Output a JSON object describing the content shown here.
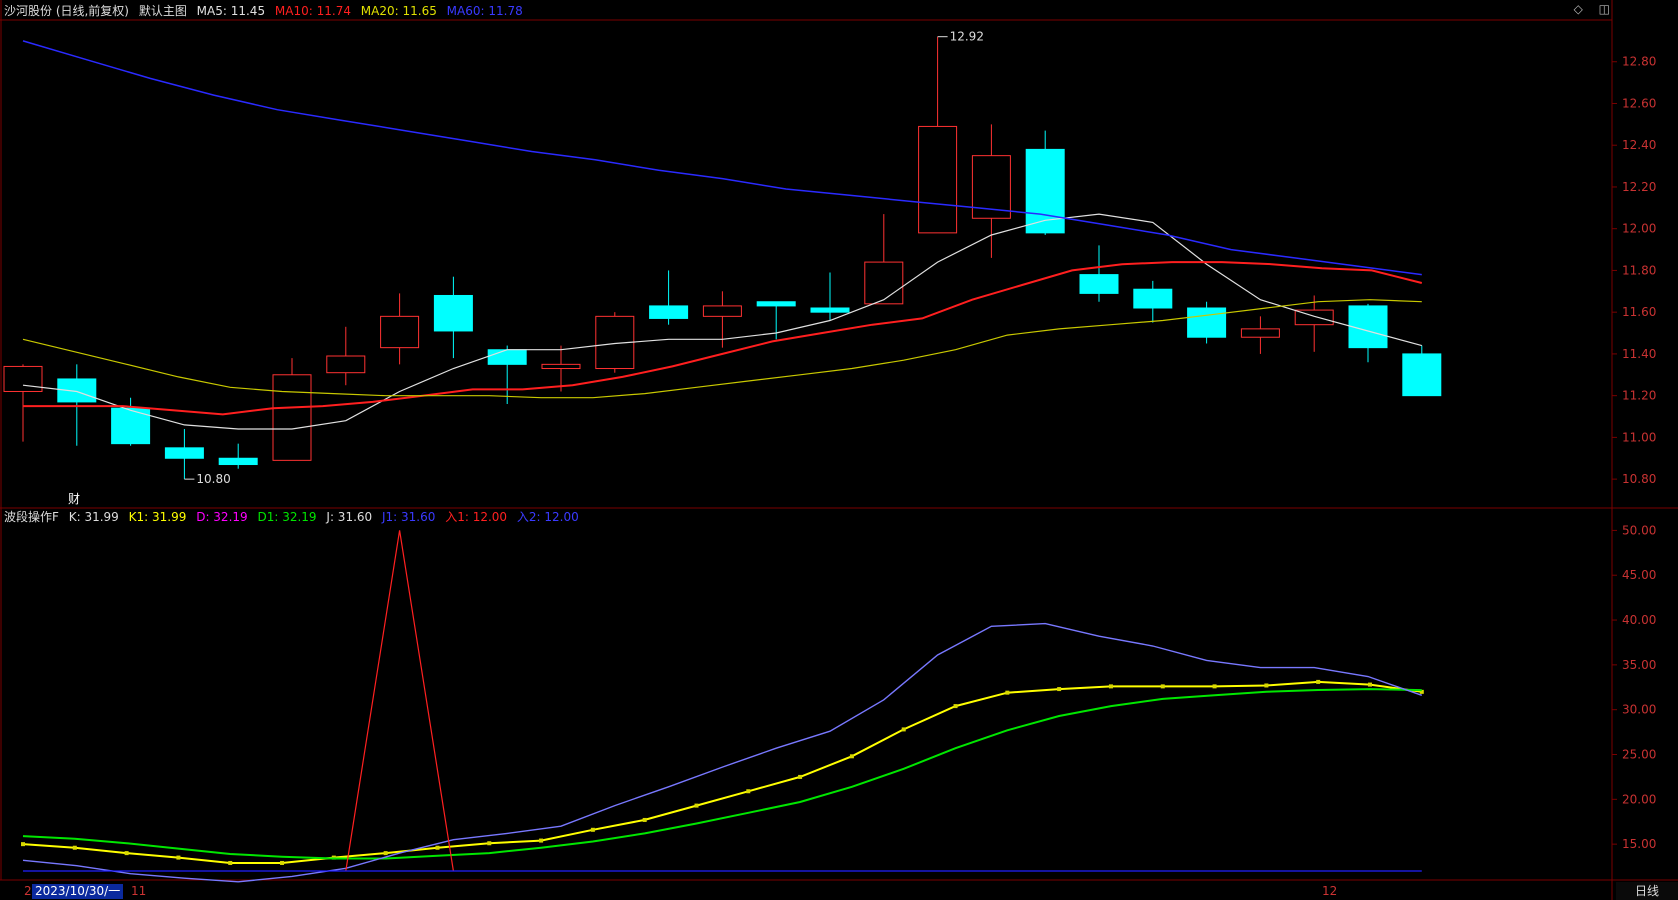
{
  "price_header": {
    "stock": "沙河股份 (日线,前复权)",
    "main_chart": "默认主图",
    "ma5": "MA5: 11.45",
    "ma10": "MA10: 11.74",
    "ma20": "MA20: 11.65",
    "ma60": "MA60: 11.78"
  },
  "indicator_header": {
    "name": "波段操作F",
    "k": "K: 31.99",
    "k1": "K1: 31.99",
    "d": "D: 32.19",
    "d1": "D1: 32.19",
    "j": "J: 31.60",
    "j1": "J1: 31.60",
    "in1": "入1: 12.00",
    "in2": "入2: 12.00"
  },
  "right_controls": "◇ ◫",
  "cai_label": "财",
  "x_axis": {
    "date_tag": "2023/10/30/一",
    "left_mark": "2",
    "month_11": "11",
    "month_12": "12",
    "period": "日线"
  },
  "colors": {
    "up": "#ff3232",
    "down": "#00ffff",
    "ma5": "#e0e0e0",
    "ma10": "#ff1f1f",
    "ma20": "#c8c800",
    "ma60": "#2a2aff",
    "grid": "#7a0000",
    "axis_text": "#c83232",
    "k": "#ffff00",
    "d": "#00e600",
    "j": "#7878ff",
    "in1": "#ff2020",
    "in2": "#2020ff"
  },
  "chart_data": [
    {
      "type": "candlestick",
      "ylim": [
        10.7,
        13.0
      ],
      "yticks": [
        "10.80",
        "11.00",
        "11.20",
        "11.40",
        "11.60",
        "11.80",
        "12.00",
        "12.20",
        "12.40",
        "12.60",
        "12.80"
      ],
      "annotations": [
        {
          "label": "12.92",
          "value": 12.92
        },
        {
          "label": "10.80",
          "value": 10.8
        }
      ],
      "candles": [
        {
          "o": 11.22,
          "h": 11.35,
          "l": 10.98,
          "c": 11.34
        },
        {
          "o": 11.28,
          "h": 11.35,
          "l": 10.96,
          "c": 11.17
        },
        {
          "o": 11.14,
          "h": 11.19,
          "l": 10.96,
          "c": 10.97
        },
        {
          "o": 10.95,
          "h": 11.04,
          "l": 10.8,
          "c": 10.9
        },
        {
          "o": 10.9,
          "h": 10.97,
          "l": 10.85,
          "c": 10.87
        },
        {
          "o": 10.89,
          "h": 11.38,
          "l": 10.89,
          "c": 11.3
        },
        {
          "o": 11.31,
          "h": 11.53,
          "l": 11.25,
          "c": 11.39
        },
        {
          "o": 11.43,
          "h": 11.69,
          "l": 11.35,
          "c": 11.58
        },
        {
          "o": 11.68,
          "h": 11.77,
          "l": 11.38,
          "c": 11.51
        },
        {
          "o": 11.42,
          "h": 11.44,
          "l": 11.16,
          "c": 11.35
        },
        {
          "o": 11.33,
          "h": 11.44,
          "l": 11.22,
          "c": 11.35
        },
        {
          "o": 11.33,
          "h": 11.6,
          "l": 11.31,
          "c": 11.58
        },
        {
          "o": 11.63,
          "h": 11.8,
          "l": 11.54,
          "c": 11.57
        },
        {
          "o": 11.58,
          "h": 11.7,
          "l": 11.43,
          "c": 11.63
        },
        {
          "o": 11.65,
          "h": 11.65,
          "l": 11.47,
          "c": 11.63
        },
        {
          "o": 11.62,
          "h": 11.79,
          "l": 11.56,
          "c": 11.6
        },
        {
          "o": 11.64,
          "h": 12.07,
          "l": 11.64,
          "c": 11.84
        },
        {
          "o": 11.98,
          "h": 12.92,
          "l": 11.98,
          "c": 12.49
        },
        {
          "o": 12.05,
          "h": 12.5,
          "l": 11.86,
          "c": 12.35
        },
        {
          "o": 12.38,
          "h": 12.47,
          "l": 11.97,
          "c": 11.98
        },
        {
          "o": 11.78,
          "h": 11.92,
          "l": 11.65,
          "c": 11.69
        },
        {
          "o": 11.71,
          "h": 11.75,
          "l": 11.55,
          "c": 11.62
        },
        {
          "o": 11.62,
          "h": 11.65,
          "l": 11.45,
          "c": 11.48
        },
        {
          "o": 11.48,
          "h": 11.58,
          "l": 11.4,
          "c": 11.52
        },
        {
          "o": 11.54,
          "h": 11.68,
          "l": 11.41,
          "c": 11.61
        },
        {
          "o": 11.63,
          "h": 11.64,
          "l": 11.36,
          "c": 11.43
        },
        {
          "o": 11.4,
          "h": 11.44,
          "l": 11.2,
          "c": 11.2
        }
      ],
      "series": [
        {
          "name": "MA5",
          "values": [
            11.25,
            11.22,
            11.13,
            11.06,
            11.04,
            11.04,
            11.08,
            11.22,
            11.33,
            11.42,
            11.42,
            11.45,
            11.47,
            11.47,
            11.5,
            11.56,
            11.66,
            11.84,
            11.97,
            12.04,
            12.07,
            12.03,
            11.83,
            11.66,
            11.58,
            11.51,
            11.44
          ]
        },
        {
          "name": "MA10",
          "values": [
            11.15,
            11.15,
            11.15,
            11.13,
            11.11,
            11.14,
            11.15,
            11.17,
            11.2,
            11.23,
            11.23,
            11.25,
            11.29,
            11.34,
            11.4,
            11.46,
            11.5,
            11.54,
            11.57,
            11.66,
            11.73,
            11.8,
            11.83,
            11.84,
            11.84,
            11.83,
            11.81,
            11.8,
            11.74
          ]
        },
        {
          "name": "MA20",
          "values": [
            11.47,
            11.41,
            11.35,
            11.29,
            11.24,
            11.22,
            11.21,
            11.2,
            11.2,
            11.2,
            11.19,
            11.19,
            11.21,
            11.24,
            11.27,
            11.3,
            11.33,
            11.37,
            11.42,
            11.49,
            11.52,
            11.54,
            11.56,
            11.59,
            11.62,
            11.65,
            11.66,
            11.65
          ]
        },
        {
          "name": "MA60",
          "values": [
            12.9,
            12.81,
            12.72,
            12.64,
            12.57,
            12.52,
            12.47,
            12.42,
            12.37,
            12.33,
            12.28,
            12.24,
            12.19,
            12.16,
            12.13,
            12.1,
            12.07,
            12.02,
            11.97,
            11.9,
            11.86,
            11.82,
            11.78
          ]
        }
      ]
    },
    {
      "type": "line",
      "ylim": [
        11.0,
        52.5
      ],
      "yticks": [
        "15.00",
        "20.00",
        "25.00",
        "30.00",
        "35.00",
        "40.00",
        "45.00",
        "50.00"
      ],
      "series": [
        {
          "name": "K",
          "values": [
            15.0,
            14.6,
            14.0,
            13.5,
            12.9,
            12.9,
            13.5,
            14.0,
            14.6,
            15.1,
            15.4,
            16.6,
            17.7,
            19.3,
            20.9,
            22.5,
            24.8,
            27.8,
            30.4,
            31.9,
            32.3,
            32.6,
            32.6,
            32.6,
            32.7,
            33.1,
            32.8,
            31.99
          ]
        },
        {
          "name": "D",
          "values": [
            15.9,
            15.6,
            15.1,
            14.5,
            13.9,
            13.6,
            13.4,
            13.4,
            13.7,
            14.0,
            14.6,
            15.3,
            16.2,
            17.3,
            18.5,
            19.7,
            21.4,
            23.4,
            25.7,
            27.7,
            29.3,
            30.4,
            31.2,
            31.6,
            32.0,
            32.2,
            32.3,
            32.19
          ]
        },
        {
          "name": "J",
          "values": [
            13.2,
            12.6,
            11.7,
            11.2,
            10.8,
            11.4,
            12.3,
            14.0,
            15.5,
            16.2,
            17.0,
            19.3,
            21.4,
            23.6,
            25.7,
            27.6,
            31.1,
            36.1,
            39.3,
            39.6,
            38.2,
            37.1,
            35.5,
            34.7,
            34.7,
            33.7,
            31.6
          ]
        },
        {
          "name": "入1",
          "values": [
            12.0,
            12.0,
            12.0,
            12.0,
            12.0,
            12.0,
            12.0,
            50.0,
            12.0
          ]
        },
        {
          "name": "入2",
          "values": [
            12.0,
            12.0
          ]
        }
      ]
    }
  ]
}
